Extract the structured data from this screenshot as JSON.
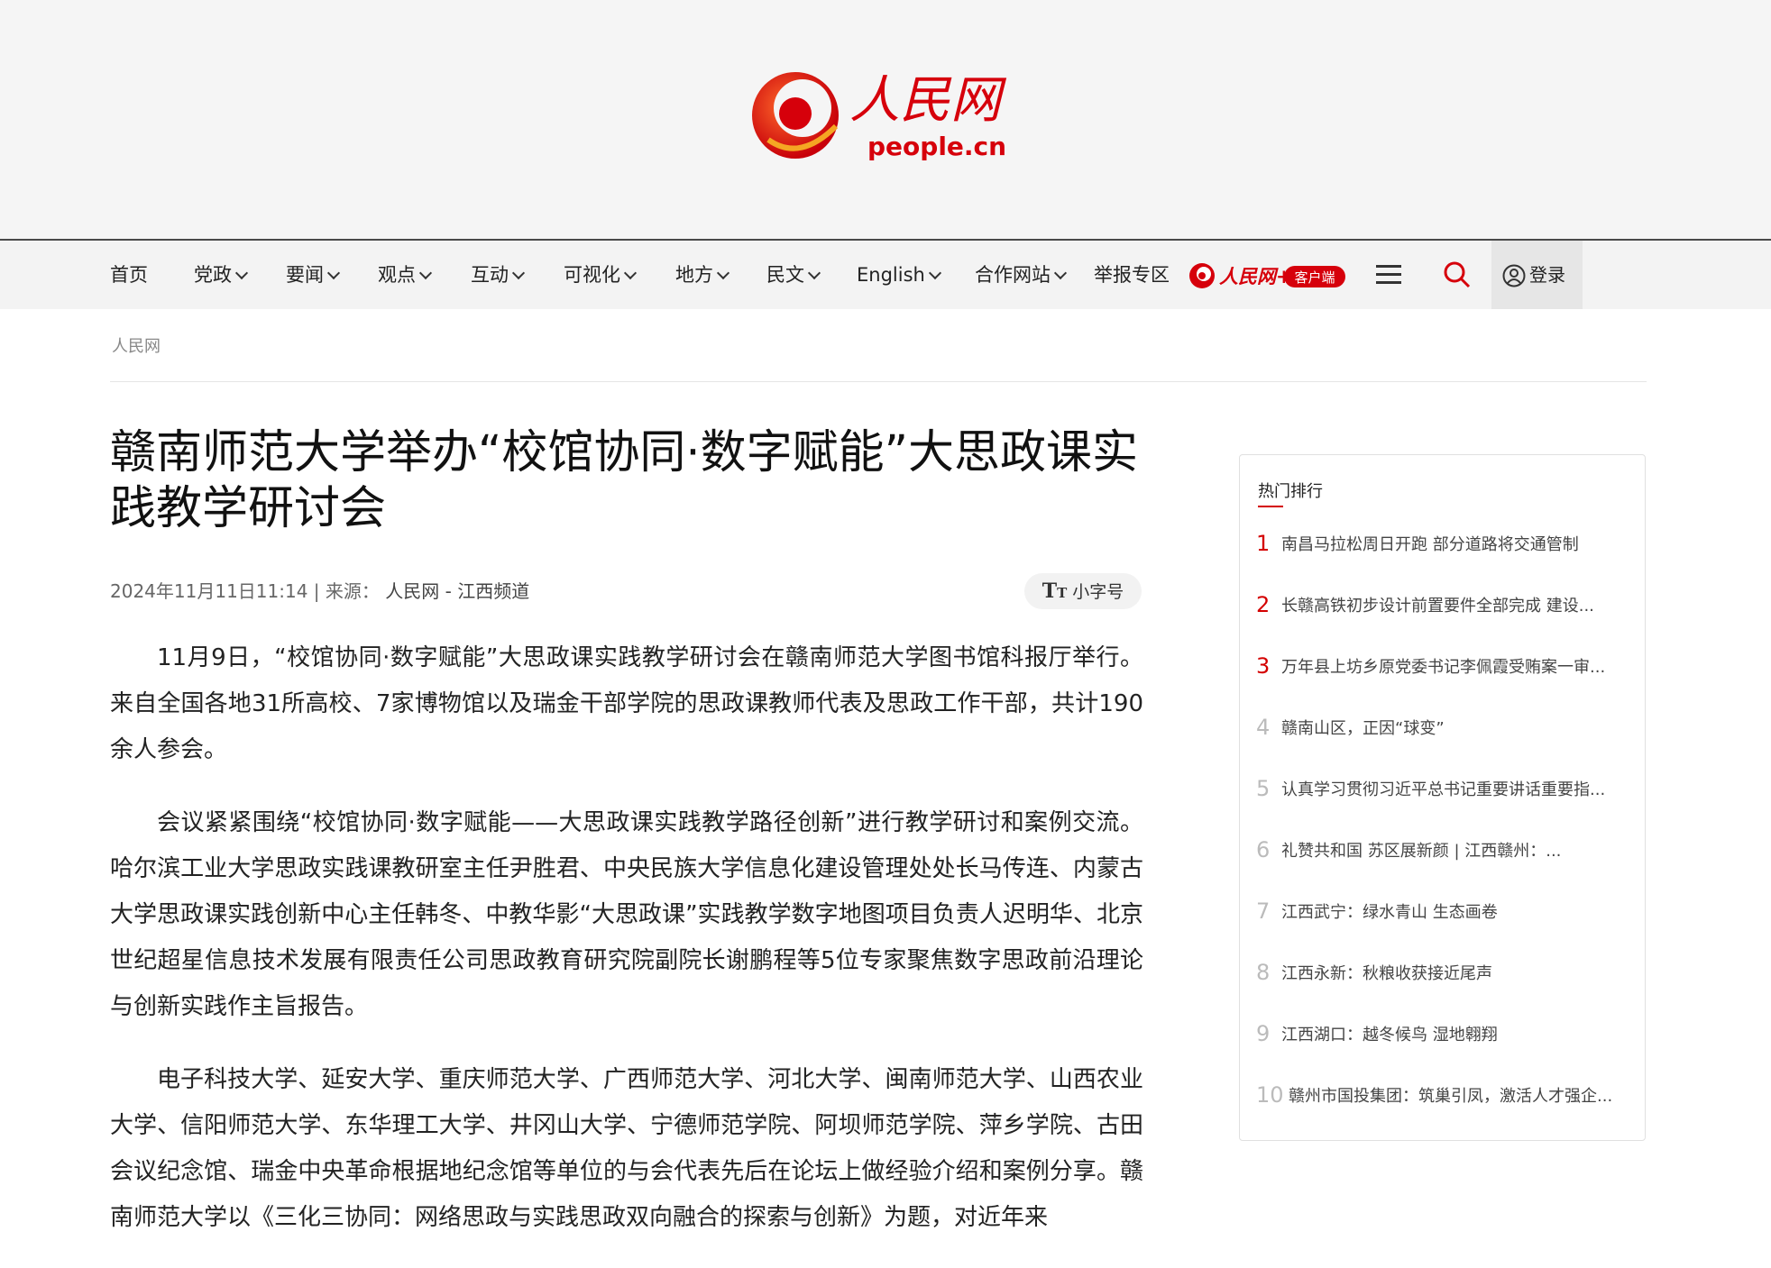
{
  "logo": {
    "name_cn": "人民网",
    "domain": "people.cn"
  },
  "nav": {
    "items": [
      {
        "label": "首页",
        "dropdown": false
      },
      {
        "label": "党政",
        "dropdown": true
      },
      {
        "label": "要闻",
        "dropdown": true
      },
      {
        "label": "观点",
        "dropdown": true
      },
      {
        "label": "互动",
        "dropdown": true
      },
      {
        "label": "可视化",
        "dropdown": true
      },
      {
        "label": "地方",
        "dropdown": true
      },
      {
        "label": "民文",
        "dropdown": true
      },
      {
        "label": "English",
        "dropdown": true
      },
      {
        "label": "合作网站",
        "dropdown": true
      },
      {
        "label": "举报专区",
        "dropdown": false
      }
    ],
    "app_badge": {
      "brand": "人民网+",
      "tag": "客户端"
    },
    "login_label": "登录"
  },
  "breadcrumb": "人民网",
  "article": {
    "title": "赣南师范大学举办“校馆协同·数字赋能”大思政课实践教学研讨会",
    "datetime": "2024年11月11日11:14",
    "source_prefix": "来源：",
    "source": "人民网 - 江西频道",
    "fontsize_label": "小字号",
    "paragraphs": [
      "11月9日，“校馆协同·数字赋能”大思政课实践教学研讨会在赣南师范大学图书馆科报厅举行。来自全国各地31所高校、7家博物馆以及瑞金干部学院的思政课教师代表及思政工作干部，共计190余人参会。",
      "会议紧紧围绕“校馆协同·数字赋能——大思政课实践教学路径创新”进行教学研讨和案例交流。哈尔滨工业大学思政实践课教研室主任尹胜君、中央民族大学信息化建设管理处处长马传连、内蒙古大学思政课实践创新中心主任韩冬、中教华影“大思政课”实践教学数字地图项目负责人迟明华、北京世纪超星信息技术发展有限责任公司思政教育研究院副院长谢鹏程等5位专家聚焦数字思政前沿理论与创新实践作主旨报告。",
      "电子科技大学、延安大学、重庆师范大学、广西师范大学、河北大学、闽南师范大学、山西农业大学、信阳师范大学、东华理工大学、井冈山大学、宁德师范学院、阿坝师范学院、萍乡学院、古田会议纪念馆、瑞金中央革命根据地纪念馆等单位的与会代表先后在论坛上做经验介绍和案例分享。赣南师范大学以《三化三协同：网络思政与实践思政双向融合的探索与创新》为题，对近年来"
    ]
  },
  "sidebar": {
    "title": "热门排行",
    "items": [
      {
        "num": "1",
        "text": "南昌马拉松周日开跑 部分道路将交通管制"
      },
      {
        "num": "2",
        "text": "长赣高铁初步设计前置要件全部完成 建设..."
      },
      {
        "num": "3",
        "text": "万年县上坊乡原党委书记李佩霞受贿案一审..."
      },
      {
        "num": "4",
        "text": "赣南山区，正因“球变”"
      },
      {
        "num": "5",
        "text": "认真学习贯彻习近平总书记重要讲话重要指..."
      },
      {
        "num": "6",
        "text": "礼赞共和国 苏区展新颜 | 江西赣州：..."
      },
      {
        "num": "7",
        "text": "江西武宁：绿水青山 生态画卷"
      },
      {
        "num": "8",
        "text": "江西永新：秋粮收获接近尾声"
      },
      {
        "num": "9",
        "text": "江西湖口：越冬候鸟 湿地翱翔"
      },
      {
        "num": "10",
        "text": "赣州市国投集团：筑巢引凤，激活人才强企..."
      }
    ]
  },
  "colors": {
    "brand_red": "#d40000",
    "nav_bg": "#f3f3f3",
    "header_bg": "#f5f5f5"
  }
}
